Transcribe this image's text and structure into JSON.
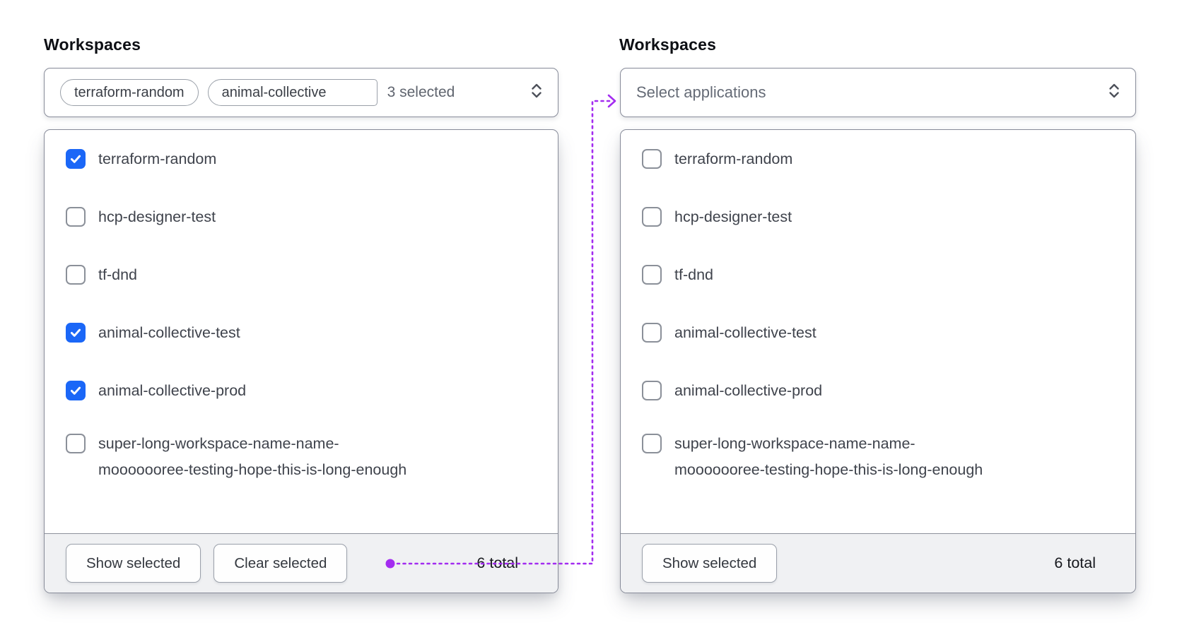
{
  "colors": {
    "checkbox_checked": "#1B67F7",
    "connector": "#A32CF0"
  },
  "left_panel": {
    "heading": "Workspaces",
    "select": {
      "tags": [
        {
          "label": "terraform-random"
        },
        {
          "label": "animal-collective"
        }
      ],
      "count": "3 selected"
    },
    "options": [
      {
        "label": "terraform-random",
        "checked": true
      },
      {
        "label": "hcp-designer-test",
        "checked": false
      },
      {
        "label": "tf-dnd",
        "checked": false
      },
      {
        "label": "animal-collective-test",
        "checked": true
      },
      {
        "label": "animal-collective-prod",
        "checked": true
      },
      {
        "label": "super-long-workspace-name-name-",
        "label2": "mooooooree-testing-hope-this-is-long-enough",
        "checked": false
      }
    ],
    "footer": {
      "show_button": "Show selected",
      "clear_button": "Clear selected",
      "total": "6 total"
    }
  },
  "right_panel": {
    "heading": "Workspaces",
    "select": {
      "placeholder": "Select applications"
    },
    "options": [
      {
        "label": "terraform-random",
        "checked": false
      },
      {
        "label": "hcp-designer-test",
        "checked": false
      },
      {
        "label": "tf-dnd",
        "checked": false
      },
      {
        "label": "animal-collective-test",
        "checked": false
      },
      {
        "label": "animal-collective-prod",
        "checked": false
      },
      {
        "label": "super-long-workspace-name-name-",
        "label2": "mooooooree-testing-hope-this-is-long-enough",
        "checked": false
      }
    ],
    "footer": {
      "show_button": "Show selected",
      "total": "6 total"
    }
  }
}
